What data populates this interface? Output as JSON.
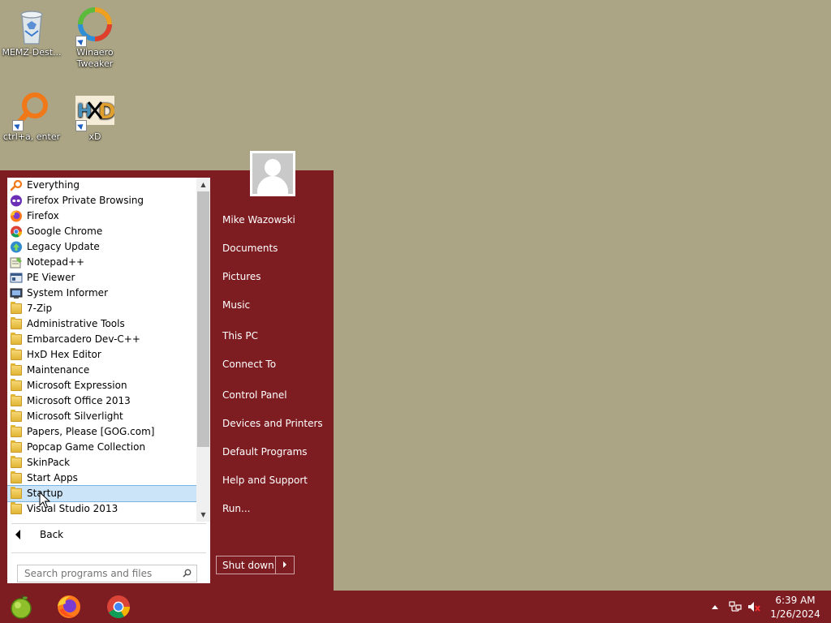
{
  "desktop": {
    "icons": [
      {
        "label": "MEMZ-Dest...",
        "icon": "recycle-bin-icon"
      },
      {
        "label": "Winaero Tweaker",
        "icon": "winaero-icon"
      },
      {
        "label": "ctrl+a, enter",
        "icon": "everything-search-icon"
      },
      {
        "label": "xD",
        "icon": "hxd-icon"
      }
    ]
  },
  "start_menu": {
    "programs": [
      {
        "label": "Everything",
        "icon": "everything-icon"
      },
      {
        "label": "Firefox Private Browsing",
        "icon": "firefox-private-icon"
      },
      {
        "label": "Firefox",
        "icon": "firefox-icon"
      },
      {
        "label": "Google Chrome",
        "icon": "chrome-icon"
      },
      {
        "label": "Legacy Update",
        "icon": "legacy-update-icon"
      },
      {
        "label": "Notepad++",
        "icon": "notepadpp-icon"
      },
      {
        "label": "PE Viewer",
        "icon": "pe-viewer-icon"
      },
      {
        "label": "System Informer",
        "icon": "system-informer-icon"
      },
      {
        "label": "7-Zip",
        "icon": "folder-icon"
      },
      {
        "label": "Administrative Tools",
        "icon": "folder-icon"
      },
      {
        "label": "Embarcadero Dev-C++",
        "icon": "folder-icon"
      },
      {
        "label": "HxD Hex Editor",
        "icon": "folder-icon"
      },
      {
        "label": "Maintenance",
        "icon": "folder-icon"
      },
      {
        "label": "Microsoft Expression",
        "icon": "folder-icon"
      },
      {
        "label": "Microsoft Office 2013",
        "icon": "folder-icon"
      },
      {
        "label": "Microsoft Silverlight",
        "icon": "folder-icon"
      },
      {
        "label": "Papers, Please [GOG.com]",
        "icon": "folder-icon"
      },
      {
        "label": "Popcap Game Collection",
        "icon": "folder-icon"
      },
      {
        "label": "SkinPack",
        "icon": "folder-icon"
      },
      {
        "label": "Start Apps",
        "icon": "folder-icon"
      },
      {
        "label": "Startup",
        "icon": "folder-icon",
        "selected": true
      },
      {
        "label": "Visual Studio 2013",
        "icon": "folder-icon"
      }
    ],
    "back_label": "Back",
    "search_placeholder": "Search programs and files",
    "right_items": [
      "Mike Wazowski",
      "Documents",
      "Pictures",
      "Music",
      "This PC",
      "Connect To",
      "Control Panel",
      "Devices and Printers",
      "Default Programs",
      "Help and Support",
      "Run..."
    ],
    "shutdown_label": "Shut down"
  },
  "taskbar": {
    "pinned": [
      "start-orb-icon",
      "firefox-icon",
      "chrome-icon"
    ],
    "clock_time": "6:39 AM",
    "clock_date": "1/26/2024"
  },
  "colors": {
    "desktop_bg": "#aba585",
    "accent": "#7d1d22",
    "selection": "#cce4f7"
  }
}
